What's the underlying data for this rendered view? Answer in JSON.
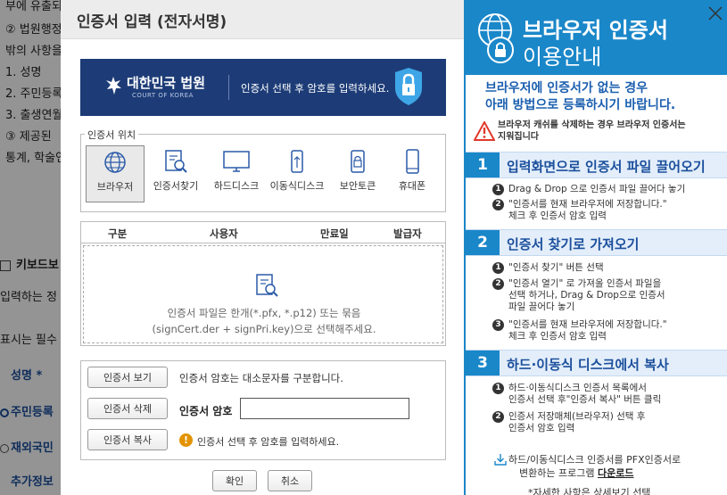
{
  "background": {
    "lines": [
      "부에 유출되",
      "② 법원행정",
      "밖의 사항을",
      "1. 성명",
      "2. 주민등록",
      "3. 출생연월",
      "③ 제공된",
      "통계, 학술연"
    ],
    "keyboard": "키보드보",
    "input_note": "입력하는 정",
    "required_note": "표시는 필수",
    "name_label": "성명 *",
    "radio_1": "주민등록",
    "radio_2": "재외국민",
    "extra": "추가정보"
  },
  "dialog": {
    "title": "인증서 입력 (전자서명)",
    "banner": {
      "court_name": "대한민국 법원",
      "court_sub": "COURT OF KOREA",
      "text": "인증서 선택 후 암호를 입력하세요."
    },
    "location": {
      "legend": "인증서 위치",
      "items": [
        {
          "label": "브라우저",
          "icon": "globe-icon"
        },
        {
          "label": "인증서찾기",
          "icon": "cert-search-icon"
        },
        {
          "label": "하드디스크",
          "icon": "monitor-icon"
        },
        {
          "label": "이동식디스크",
          "icon": "usb-icon"
        },
        {
          "label": "보안토큰",
          "icon": "token-icon"
        },
        {
          "label": "휴대폰",
          "icon": "phone-icon"
        }
      ]
    },
    "table": {
      "headers": [
        "구분",
        "사용자",
        "만료일",
        "발급자"
      ],
      "drop_line_1": "인증서 파일은 한개(*.pfx, *.p12) 또는 묶음",
      "drop_line_2": "(signCert.der + signPri.key)으로 선택해주세요."
    },
    "actions": {
      "view": "인증서 보기",
      "delete": "인증서 삭제",
      "copy": "인증서 복사",
      "case_note": "인증서 암호는 대소문자를 구분합니다.",
      "password_label": "인증서 암호",
      "password_value": "",
      "warning": "인증서 선택 후 암호를 입력하세요."
    },
    "confirm": "확인",
    "cancel": "취소"
  },
  "guide": {
    "title_line_1": "브라우저 인증서",
    "title_line_2": "이용안내",
    "intro_line_1": "브라우저에 인증서가 없는 경우",
    "intro_line_2": "아래 방법으로 등록하시기 바랍니다.",
    "warn_line_1": "브라우저 캐쉬를 삭제하는 경우 브라우저 인증서는",
    "warn_line_2": "지워집니다",
    "steps": [
      {
        "num": "1",
        "title": "입력화면으로 인증서 파일 끌어오기",
        "items": [
          {
            "n": "1",
            "l1": "Drag & Drop 으로 인증서 파일 끌어다 놓기",
            "l2": "",
            "l3": ""
          },
          {
            "n": "2",
            "l1": "\"인증서를 현재 브라우저에 저장합니다.\"",
            "l2": "체크 후 인증서 암호 입력",
            "l3": ""
          }
        ]
      },
      {
        "num": "2",
        "title": "인증서 찾기로 가져오기",
        "items": [
          {
            "n": "1",
            "l1": "\"인증서 찾기\" 버튼 선택",
            "l2": "",
            "l3": ""
          },
          {
            "n": "2",
            "l1": "\"인증서 열기\" 로 가져올 인증서 파일을",
            "l2": "선택 하거나, Drag & Drop으로 인증서",
            "l3": "파일 끌어다 놓기"
          },
          {
            "n": "3",
            "l1": "\"인증서를 현재 브라우저에 저장합니다.\"",
            "l2": "체크 후 인증서 암호 입력",
            "l3": ""
          }
        ]
      },
      {
        "num": "3",
        "title": "하드·이동식 디스크에서 복사",
        "items": [
          {
            "n": "1",
            "l1": "하드·이동식디스크 인증서 목록에서",
            "l2": "인증서 선택 후\"인증서 복사\" 버튼 클릭",
            "l3": ""
          },
          {
            "n": "2",
            "l1": "인증서 저장매체(브라우저) 선택 후",
            "l2": "인증서 암호 입력",
            "l3": ""
          }
        ]
      }
    ],
    "convert_line_1": "하드/이동식디스크 인증서를 PFX인증서로",
    "convert_line_2": "변환하는 프로그램",
    "convert_link": "다운로드",
    "more": "*자세한 사항은 상세보기 선택"
  }
}
